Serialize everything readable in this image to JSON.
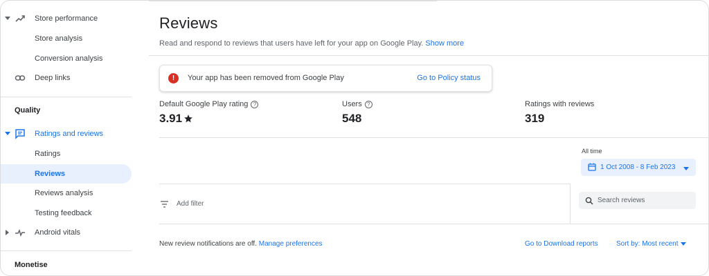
{
  "sidebar": {
    "items": [
      {
        "label": "Store performance",
        "icon": "trending-up-icon"
      },
      {
        "label": "Store analysis"
      },
      {
        "label": "Conversion analysis"
      },
      {
        "label": "Deep links",
        "icon": "link-icon"
      }
    ],
    "section_quality": "Quality",
    "quality_items": [
      {
        "label": "Ratings and reviews",
        "icon": "reviews-icon"
      },
      {
        "label": "Ratings"
      },
      {
        "label": "Reviews"
      },
      {
        "label": "Reviews analysis"
      },
      {
        "label": "Testing feedback"
      },
      {
        "label": "Android vitals",
        "icon": "vitals-icon"
      }
    ],
    "section_monetise": "Monetise"
  },
  "main": {
    "title": "Reviews",
    "subtitle": "Read and respond to reviews that users have left for your app on Google Play.",
    "subtitle_link": "Show more",
    "alert": {
      "text": "Your app has been removed from Google Play",
      "link": "Go to Policy status"
    },
    "stats": [
      {
        "label": "Default Google Play rating",
        "value": "3.91",
        "has_help": true,
        "has_star": true
      },
      {
        "label": "Users",
        "value": "548",
        "has_help": true
      },
      {
        "label": "Ratings with reviews",
        "value": "319"
      }
    ],
    "date_range_label": "All time",
    "date_range": "1 Oct 2008 - 8 Feb 2023",
    "add_filter": "Add filter",
    "search_placeholder": "Search reviews",
    "notifications_text": "New review notifications are off.",
    "notifications_link": "Manage preferences",
    "download_reports": "Go to Download reports",
    "sort": "Sort by: Most recent"
  },
  "colors": {
    "accent": "#1a73e8",
    "selected_bg": "#e8f0fe",
    "alert_red": "#d93025"
  }
}
